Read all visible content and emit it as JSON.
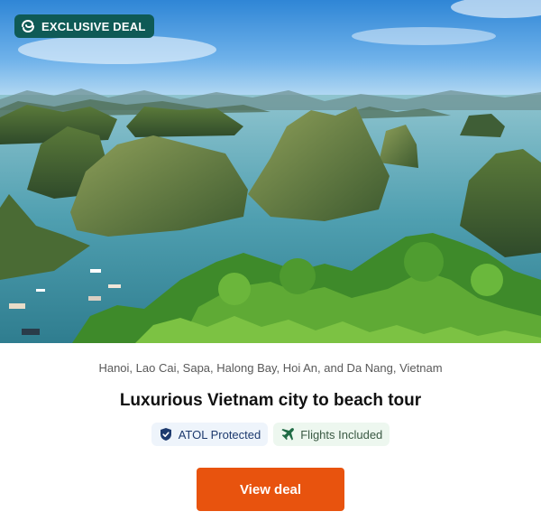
{
  "badge": {
    "label": "EXCLUSIVE DEAL",
    "icon": "deal-logo-icon"
  },
  "image": {
    "subject": "halong-bay-karst-islands"
  },
  "deal": {
    "location": "Hanoi, Lao Cai, Sapa, Halong Bay, Hoi An, and Da Nang, Vietnam",
    "title": "Luxurious Vietnam city to beach tour",
    "tags": [
      {
        "label": "ATOL Protected",
        "icon": "shield-icon"
      },
      {
        "label": "Flights Included",
        "icon": "plane-icon"
      }
    ],
    "cta_label": "View deal"
  },
  "colors": {
    "badge_bg": "#0f5a56",
    "cta_bg": "#e8530e",
    "atol_tag_bg": "#eef4fb",
    "flights_tag_bg": "#edf7ef",
    "plane_icon": "#1f6b45",
    "shield_icon": "#1d3a6e"
  }
}
